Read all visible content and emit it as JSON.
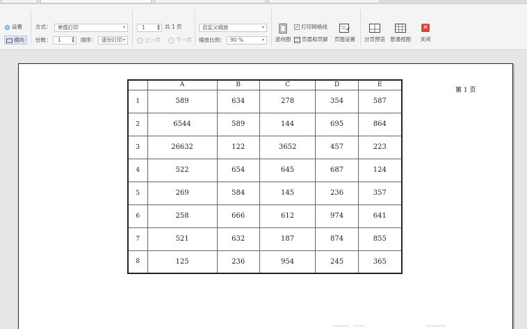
{
  "toolbar": {
    "settings_label": "设置",
    "layout_label": "横向",
    "method_label": "方式：",
    "method_value": "单面打印",
    "copies_label": "份数：",
    "copies_value": "1",
    "order_label": "顺序：",
    "order_value": "逐份打印",
    "page_input_value": "1",
    "page_total": "共 1 页",
    "prev_page": "上一页",
    "next_page": "下一页",
    "scale_mode_value": "自定义缩放",
    "scale_label": "缩放比例：",
    "scale_value": "90 %",
    "print_grid_label": "打印网格线",
    "print_grid_checked": true,
    "header_footer_label": "页眉和页脚",
    "portrait_label": "竖向图",
    "page_setup_label": "页面设置",
    "page_break_preview_label": "分页预览",
    "normal_view_label": "普通视图",
    "close_label": "关闭"
  },
  "page": {
    "page_number": "第 1 页"
  },
  "sheet": {
    "columns": [
      "A",
      "B",
      "C",
      "D",
      "E"
    ],
    "rows": [
      {
        "n": "1",
        "cells": [
          "589",
          "634",
          "278",
          "354",
          "587"
        ]
      },
      {
        "n": "2",
        "cells": [
          "6544",
          "589",
          "144",
          "695",
          "864"
        ]
      },
      {
        "n": "3",
        "cells": [
          "26632",
          "122",
          "3652",
          "457",
          "223"
        ]
      },
      {
        "n": "4",
        "cells": [
          "522",
          "654",
          "645",
          "687",
          "124"
        ]
      },
      {
        "n": "5",
        "cells": [
          "269",
          "584",
          "145",
          "236",
          "357"
        ]
      },
      {
        "n": "6",
        "cells": [
          "258",
          "666",
          "612",
          "974",
          "641"
        ]
      },
      {
        "n": "7",
        "cells": [
          "521",
          "632",
          "187",
          "874",
          "855"
        ]
      },
      {
        "n": "8",
        "cells": [
          "125",
          "236",
          "954",
          "245",
          "365"
        ]
      }
    ]
  },
  "colors": {
    "accent_blue": "#4a7fcf",
    "close_red": "#d9443e",
    "tab_green": "#4caf50"
  },
  "icons": {
    "settings": "gear-icon",
    "layout": "landscape-icon",
    "print_grid": "checkbox-icon",
    "header_footer": "header-footer-icon",
    "portrait": "portrait-page-icon",
    "page_setup": "page-setup-icon",
    "page_break_preview": "page-break-icon",
    "normal_view": "grid-view-icon",
    "close": "close-icon"
  }
}
